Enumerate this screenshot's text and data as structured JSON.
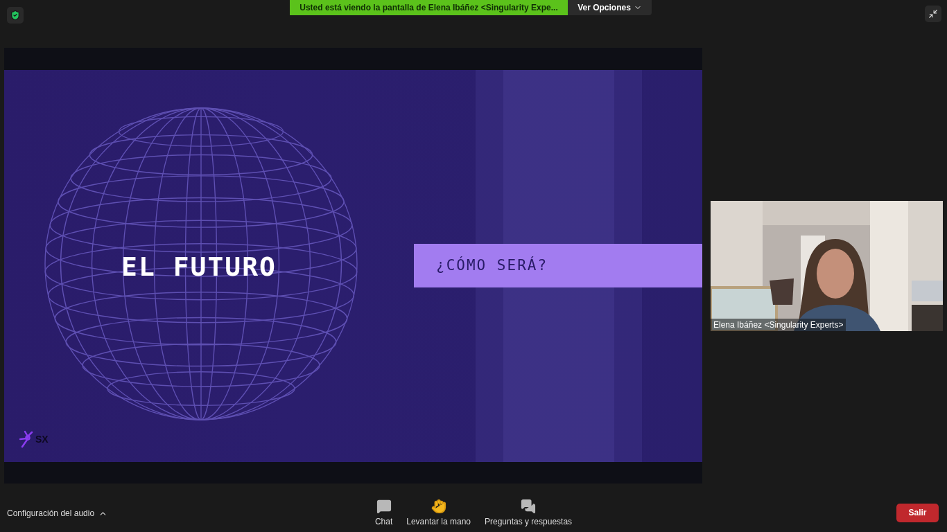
{
  "banner": {
    "text": "Usted está viendo la pantalla de Elena Ibáñez <Singularity Expe...",
    "options_label": "Ver Opciones"
  },
  "slide": {
    "title": "EL FUTURO",
    "subtitle": "¿CÓMO SERÁ?",
    "logo_text": "SX"
  },
  "video": {
    "participant": "Elena Ibáñez <Singularity Experts>"
  },
  "toolbar": {
    "audio_label": "Configuración del audio",
    "leave_label": "Salir",
    "items": [
      {
        "label": "Chat",
        "kind": "chat"
      },
      {
        "label": "Levantar la mano",
        "kind": "hand"
      },
      {
        "label": "Preguntas y respuestas",
        "kind": "qa"
      }
    ]
  }
}
